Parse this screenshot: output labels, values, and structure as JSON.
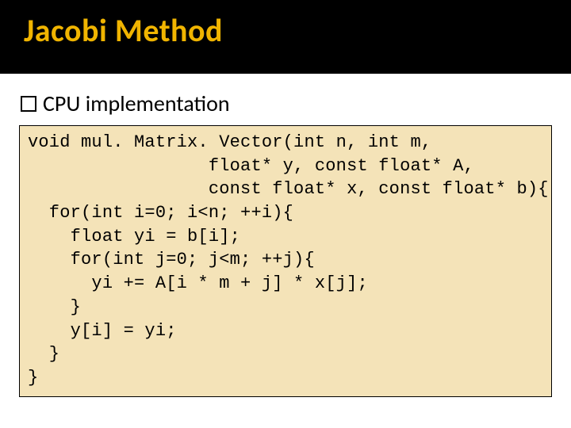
{
  "slide": {
    "title": "Jacobi Method",
    "bullet": "CPU implementation",
    "code": "void mul. Matrix. Vector(int n, int m,\n                 float* y, const float* A,\n                 const float* x, const float* b){\n  for(int i=0; i<n; ++i){\n    float yi = b[i];\n    for(int j=0; j<m; ++j){\n      yi += A[i * m + j] * x[j];\n    }\n    y[i] = yi;\n  }\n}"
  },
  "colors": {
    "title_band_bg": "#000000",
    "title_color": "#f0b400",
    "code_bg": "#f4e3b8"
  }
}
